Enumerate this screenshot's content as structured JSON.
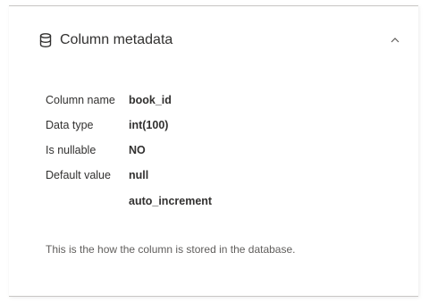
{
  "panel": {
    "title": "Column metadata",
    "icon": "database-icon",
    "collapse_icon": "chevron-up-icon"
  },
  "metadata": [
    {
      "label": "Column name",
      "value": "book_id"
    },
    {
      "label": "Data type",
      "value": "int(100)"
    },
    {
      "label": "Is nullable",
      "value": "NO"
    },
    {
      "label": "Default value",
      "value": "null"
    },
    {
      "label": "",
      "value": "auto_increment"
    }
  ],
  "note": "This is the how the column is stored in the database."
}
